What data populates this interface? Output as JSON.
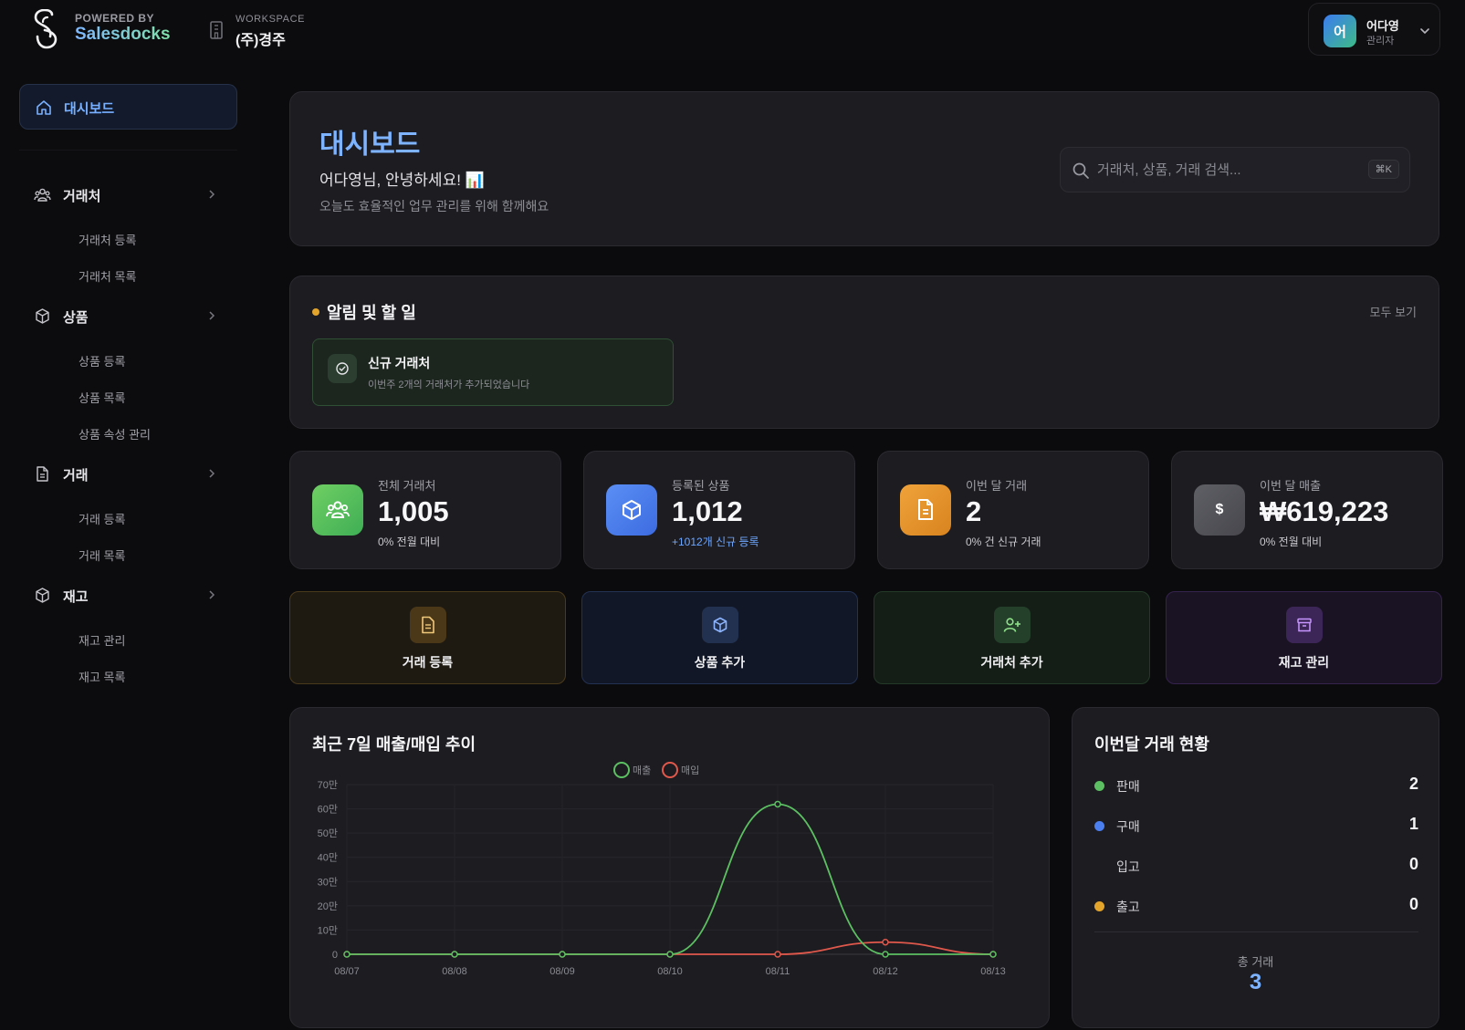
{
  "topbar": {
    "powered_by": "POWERED BY",
    "brand": "Salesdocks",
    "workspace_label": "WORKSPACE",
    "workspace_name": "(주)경주",
    "user": {
      "avatar_initial": "어",
      "name": "어다영",
      "role": "관리자"
    }
  },
  "sidebar": {
    "active": {
      "label": "대시보드",
      "icon": "home-icon"
    },
    "sections": [
      {
        "label": "거래처",
        "icon": "users-icon",
        "items": [
          "거래처 등록",
          "거래처 목록"
        ]
      },
      {
        "label": "상품",
        "icon": "box-icon",
        "items": [
          "상품 등록",
          "상품 목록",
          "상품 속성 관리"
        ]
      },
      {
        "label": "거래",
        "icon": "document-icon",
        "items": [
          "거래 등록",
          "거래 목록"
        ]
      },
      {
        "label": "재고",
        "icon": "box-icon",
        "items": [
          "재고 관리",
          "재고 목록"
        ]
      }
    ]
  },
  "hero": {
    "title": "대시보드",
    "greeting": "어다영님, 안녕하세요! 📊",
    "subtitle": "오늘도 효율적인 업무 관리를 위해 함께해요",
    "search_placeholder": "거래처, 상품, 거래 검색...",
    "shortcut": "⌘K"
  },
  "alerts": {
    "title": "알림 및 할 일",
    "view_all": "모두 보기",
    "items": [
      {
        "title": "신규 거래처",
        "desc": "이번주 2개의 거래처가 추가되었습니다"
      }
    ]
  },
  "stats": [
    {
      "label": "전체 거래처",
      "value": "1,005",
      "sub": "0% 전월 대비",
      "icon": "users-icon",
      "color": "#5cc062"
    },
    {
      "label": "등록된 상품",
      "value": "1,012",
      "sub": "+1012개 신규 등록",
      "icon": "box-icon",
      "color": "#4b7ff0"
    },
    {
      "label": "이번 달 거래",
      "value": "2",
      "sub": "0% 건 신규 거래",
      "icon": "document-icon",
      "color": "#e8952a"
    },
    {
      "label": "이번 달 매출",
      "value": "₩619,223",
      "sub": "0% 전월 대비",
      "icon": "dollar-icon",
      "color": "#55555b"
    }
  ],
  "quick_actions": [
    {
      "label": "거래 등록",
      "icon": "document-icon",
      "accent": "#e3a42c"
    },
    {
      "label": "상품 추가",
      "icon": "box-icon",
      "accent": "#5a8cf0"
    },
    {
      "label": "거래처 추가",
      "icon": "user-plus-icon",
      "accent": "#5cc062"
    },
    {
      "label": "재고 관리",
      "icon": "archive-icon",
      "accent": "#a86ae8"
    }
  ],
  "chart_data": {
    "type": "line",
    "title": "최근 7일 매출/매입 추이",
    "x": [
      "08/07",
      "08/08",
      "08/09",
      "08/10",
      "08/11",
      "08/12",
      "08/13"
    ],
    "series": [
      {
        "name": "매출",
        "color": "#5cc062",
        "values": [
          0,
          0,
          0,
          0,
          619223,
          0,
          0
        ]
      },
      {
        "name": "매입",
        "color": "#e0584b",
        "values": [
          0,
          0,
          0,
          0,
          0,
          50000,
          0
        ]
      }
    ],
    "y_ticks": [
      "0",
      "10만",
      "20만",
      "30만",
      "40만",
      "50만",
      "60만",
      "70만"
    ],
    "ylim": [
      0,
      700000
    ],
    "grid": true,
    "legend": "top-center"
  },
  "status": {
    "title": "이번달 거래 현황",
    "rows": [
      {
        "label": "판매",
        "value": "2",
        "color": "#5cc062"
      },
      {
        "label": "구매",
        "value": "1",
        "color": "#4b7ff0"
      },
      {
        "label": "입고",
        "value": "0",
        "color": ""
      },
      {
        "label": "출고",
        "value": "0",
        "color": "#e3a42c"
      }
    ],
    "total_label": "총 거래",
    "total_value": "3"
  }
}
